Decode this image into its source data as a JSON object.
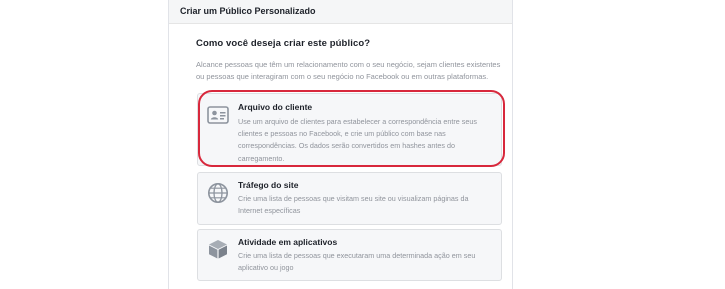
{
  "dialog": {
    "title": "Criar um Público Personalizado"
  },
  "main": {
    "question": "Como você deseja criar este público?",
    "description": "Alcance pessoas que têm um relacionamento com o seu negócio, sejam clientes existentes ou pessoas que interagiram com o seu negócio no Facebook ou em outras plataformas."
  },
  "options": [
    {
      "icon": "contact-card-icon",
      "title": "Arquivo do cliente",
      "description": "Use um arquivo de clientes para estabelecer a correspondência entre seus clientes e pessoas no Facebook, e crie um público com base nas correspondências. Os dados serão convertidos em hashes antes do carregamento."
    },
    {
      "icon": "globe-icon",
      "title": "Tráfego do site",
      "description": "Crie uma lista de pessoas que visitam seu site ou visualizam páginas da Internet específicas"
    },
    {
      "icon": "cube-icon",
      "title": "Atividade em aplicativos",
      "description": "Crie uma lista de pessoas que executaram uma determinada ação em seu aplicativo ou jogo"
    }
  ],
  "colors": {
    "highlight": "#d8283c",
    "icon": "#8d949e",
    "header_bg": "#f5f6f7"
  }
}
